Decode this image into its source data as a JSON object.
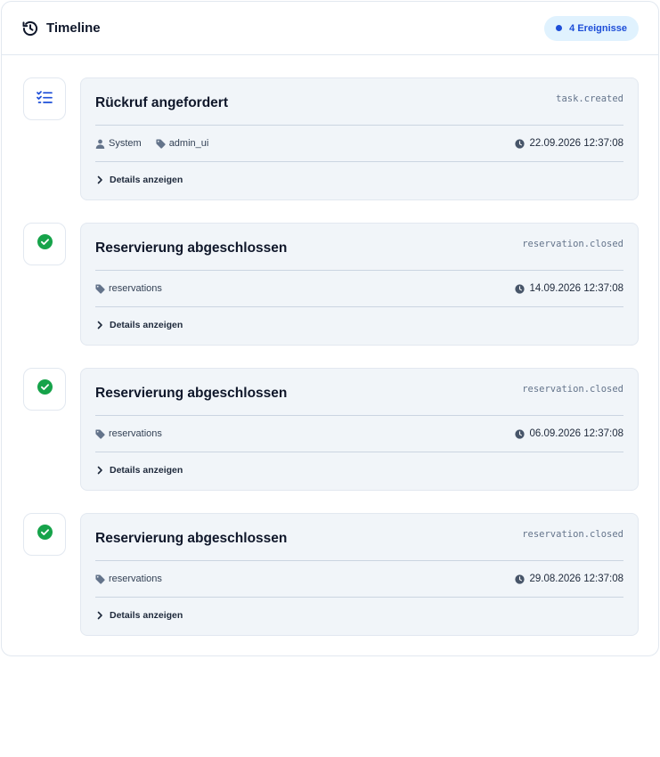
{
  "header": {
    "title": "Timeline",
    "count_label": "4 Ereignisse"
  },
  "colors": {
    "accent_blue": "#1d4ed8",
    "success_green": "#16a34a",
    "card_bg": "#f1f5f9"
  },
  "events": [
    {
      "icon": "task-list-icon",
      "title": "Rückruf angefordert",
      "type": "task.created",
      "actor": "System",
      "source": "admin_ui",
      "timestamp": "22.09.2026 12:37:08",
      "details_label": "Details anzeigen"
    },
    {
      "icon": "check-circle-icon",
      "title": "Reservierung abgeschlossen",
      "type": "reservation.closed",
      "source": "reservations",
      "timestamp": "14.09.2026 12:37:08",
      "details_label": "Details anzeigen"
    },
    {
      "icon": "check-circle-icon",
      "title": "Reservierung abgeschlossen",
      "type": "reservation.closed",
      "source": "reservations",
      "timestamp": "06.09.2026 12:37:08",
      "details_label": "Details anzeigen"
    },
    {
      "icon": "check-circle-icon",
      "title": "Reservierung abgeschlossen",
      "type": "reservation.closed",
      "source": "reservations",
      "timestamp": "29.08.2026 12:37:08",
      "details_label": "Details anzeigen"
    }
  ]
}
